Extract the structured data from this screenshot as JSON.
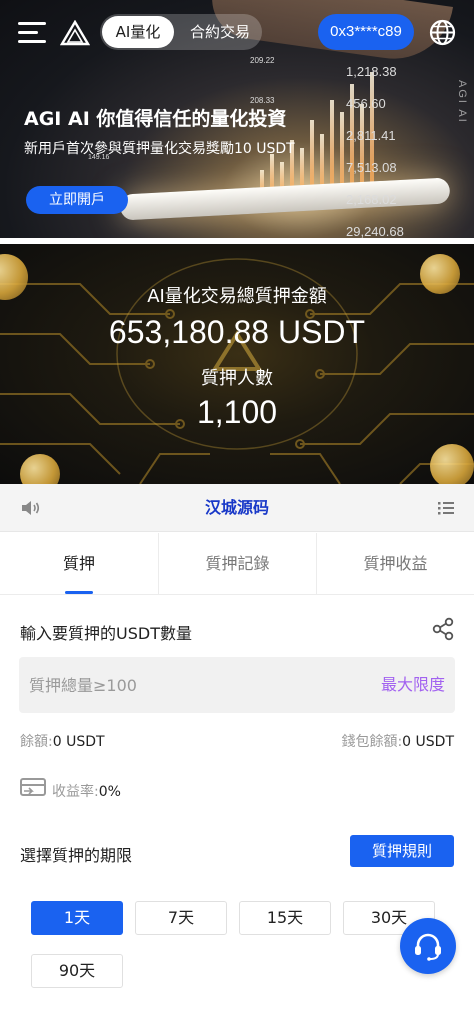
{
  "header": {
    "tab_quant": "AI量化",
    "tab_contract": "合約交易",
    "wallet_address": "0x3****c89"
  },
  "banner": {
    "title": "AGI AI 你值得信任的量化投資",
    "subtitle": "新用戶首次參與質押量化交易獎勵10 USDT",
    "open_account": "立即開戶",
    "side_text": "AGI AI",
    "numbers": [
      "1,218.38",
      "456.60",
      "2,811.41",
      "7,513.08",
      "2,168.02",
      "29,240.68",
      "209.22",
      "208.33",
      "149.16"
    ]
  },
  "stats": {
    "total_label": "AI量化交易總質押金額",
    "total_value": "653,180.88 USDT",
    "count_label": "質押人數",
    "count_value": "1,100"
  },
  "notice": {
    "text": "汉城源码"
  },
  "tabs": [
    "質押",
    "質押記錄",
    "質押收益"
  ],
  "form": {
    "input_label": "輸入要質押的USDT數量",
    "amount_placeholder": "質押總量≥100",
    "max_label": "最大限度",
    "balance_label": "餘額:",
    "balance_value": "0 USDT",
    "wallet_balance_label": "錢包餘額:",
    "wallet_balance_value": "0 USDT",
    "rate_label": "收益率:",
    "rate_value": "0%",
    "period_label": "選擇質押的期限",
    "rules_button": "質押規則",
    "periods": [
      "1天",
      "7天",
      "15天",
      "30天",
      "90天"
    ]
  },
  "colors": {
    "accent": "#1a62f0",
    "max_link": "#a262f0",
    "notice_text": "#1838c8"
  }
}
